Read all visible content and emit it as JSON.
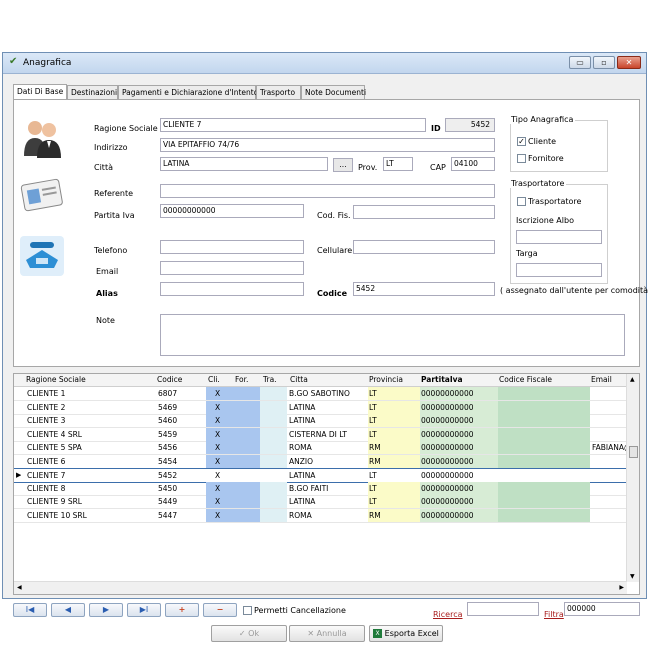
{
  "window": {
    "title": "Anagrafica",
    "minimize": "▭",
    "maximize": "▫",
    "close": "✕"
  },
  "tabs": [
    "Dati Di Base",
    "Destinazioni",
    "Pagamenti e Dichiarazione d'Intento",
    "Trasporto",
    "Note Documenti"
  ],
  "form": {
    "ragione_sociale_label": "Ragione Sociale",
    "ragione_sociale": "CLIENTE 7",
    "id_label": "ID",
    "id": "5452",
    "indirizzo_label": "Indirizzo",
    "indirizzo": "VIA EPITAFFIO 74/76",
    "citta_label": "Città",
    "citta": "LATINA",
    "lookup_btn": "...",
    "prov_label": "Prov.",
    "prov": "LT",
    "cap_label": "CAP",
    "cap": "04100",
    "referente_label": "Referente",
    "referente": "",
    "partita_iva_label": "Partita Iva",
    "partita_iva": "00000000000",
    "cod_fis_label": "Cod. Fis.",
    "cod_fis": "",
    "telefono_label": "Telefono",
    "telefono": "",
    "cellulare_label": "Cellulare",
    "cellulare": "",
    "email_label": "Email",
    "email": "",
    "alias_label": "Alias",
    "alias": "",
    "codice_label": "Codice",
    "codice": "5452",
    "codice_note": "( assegnato dall'utente per comodità )",
    "note_label": "Note",
    "note": ""
  },
  "tipo_anagrafica": {
    "title": "Tipo Anagrafica",
    "cliente": "Cliente",
    "fornitore": "Fornitore",
    "cliente_checked": "✓",
    "fornitore_checked": ""
  },
  "trasportatore": {
    "title": "Trasportatore",
    "trasportatore": "Trasportatore",
    "iscrizione_label": "Iscrizione Albo",
    "targa_label": "Targa",
    "iscrizione": "",
    "targa": ""
  },
  "grid": {
    "columns": [
      "Ragione Sociale",
      "Codice",
      "Cli.",
      "For.",
      "Tra.",
      "Citta",
      "Provincia",
      "PartitaIva",
      "Codice Fiscale",
      "Email"
    ],
    "rows": [
      {
        "rs": "CLIENTE 1",
        "cod": "6807",
        "cli": "X",
        "for": "",
        "tra": "",
        "citta": "B.GO SABOTINO",
        "prov": "LT",
        "piva": "00000000000",
        "cf": "",
        "email": ""
      },
      {
        "rs": "CLIENTE 2",
        "cod": "5469",
        "cli": "X",
        "for": "",
        "tra": "",
        "citta": "LATINA",
        "prov": "LT",
        "piva": "00000000000",
        "cf": "",
        "email": ""
      },
      {
        "rs": "CLIENTE 3",
        "cod": "5460",
        "cli": "X",
        "for": "",
        "tra": "",
        "citta": "LATINA",
        "prov": "LT",
        "piva": "00000000000",
        "cf": "",
        "email": ""
      },
      {
        "rs": "CLIENTE 4 SRL",
        "cod": "5459",
        "cli": "X",
        "for": "",
        "tra": "",
        "citta": "CISTERNA DI LT",
        "prov": "LT",
        "piva": "00000000000",
        "cf": "",
        "email": ""
      },
      {
        "rs": "CLIENTE 5 SPA",
        "cod": "5456",
        "cli": "X",
        "for": "",
        "tra": "",
        "citta": "ROMA",
        "prov": "RM",
        "piva": "00000000000",
        "cf": "",
        "email": "FABIANA@"
      },
      {
        "rs": "CLIENTE 6",
        "cod": "5454",
        "cli": "X",
        "for": "",
        "tra": "",
        "citta": "ANZIO",
        "prov": "RM",
        "piva": "00000000000",
        "cf": "",
        "email": ""
      },
      {
        "rs": "CLIENTE 7",
        "cod": "5452",
        "cli": "X",
        "for": "",
        "tra": "",
        "citta": "LATINA",
        "prov": "LT",
        "piva": "00000000000",
        "cf": "",
        "email": ""
      },
      {
        "rs": "CLIENTE 8",
        "cod": "5450",
        "cli": "X",
        "for": "",
        "tra": "",
        "citta": "B.GO FAITI",
        "prov": "LT",
        "piva": "00000000000",
        "cf": "",
        "email": ""
      },
      {
        "rs": "CLIENTE 9 SRL",
        "cod": "5449",
        "cli": "X",
        "for": "",
        "tra": "",
        "citta": "LATINA",
        "prov": "LT",
        "piva": "00000000000",
        "cf": "",
        "email": ""
      },
      {
        "rs": "CLIENTE 10 SRL",
        "cod": "5447",
        "cli": "X",
        "for": "",
        "tra": "",
        "citta": "ROMA",
        "prov": "RM",
        "piva": "00000000000",
        "cf": "",
        "email": ""
      }
    ],
    "selected_marker": "▶",
    "selected_index": 6
  },
  "nav": {
    "first": "I◀",
    "prev": "◀",
    "next": "▶",
    "last": "▶I",
    "add": "+",
    "remove": "−"
  },
  "permetti_cancellazione": "Permetti Cancellazione",
  "ricerca_label": "Ricerca",
  "ricerca": "",
  "filtra_label": "Filtra",
  "filtra": "000000",
  "buttons": {
    "ok": "Ok",
    "annulla": "Annulla",
    "esporta": "Esporta Excel"
  },
  "colors": {
    "cli_col": "#a9c6ef",
    "for_col": "#a9c6ef",
    "tra_col": "#dff0f4",
    "prov_col": "#fbfbc8",
    "piva_col": "#d7ecd5",
    "cf_col": "#bfe0c4"
  }
}
